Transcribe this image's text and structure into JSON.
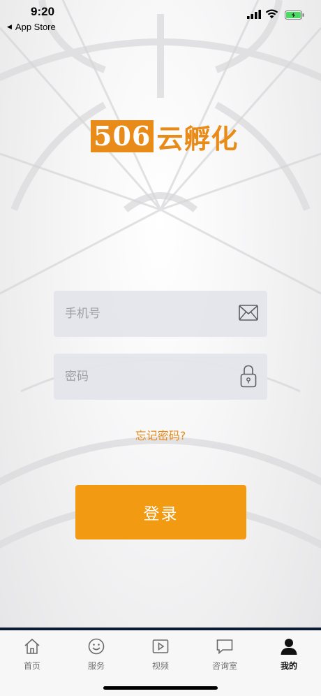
{
  "status_bar": {
    "time": "9:20",
    "back_label": "App Store",
    "battery_color": "#4cd964"
  },
  "logo": {
    "number": "506",
    "name": "云孵化",
    "brand_color": "#e88b19"
  },
  "form": {
    "phone_placeholder": "手机号",
    "phone_icon": "envelope-icon",
    "password_placeholder": "密码",
    "password_icon": "lock-icon",
    "forgot_label": "忘记密码?",
    "login_label": "登录",
    "login_color": "#f29a12"
  },
  "tab_bar": {
    "items": [
      {
        "label": "首页",
        "icon": "home-icon",
        "active": false
      },
      {
        "label": "服务",
        "icon": "smile-icon",
        "active": false
      },
      {
        "label": "视频",
        "icon": "video-play-icon",
        "active": false
      },
      {
        "label": "咨询室",
        "icon": "chat-icon",
        "active": false
      },
      {
        "label": "我的",
        "icon": "user-icon",
        "active": true
      }
    ]
  }
}
